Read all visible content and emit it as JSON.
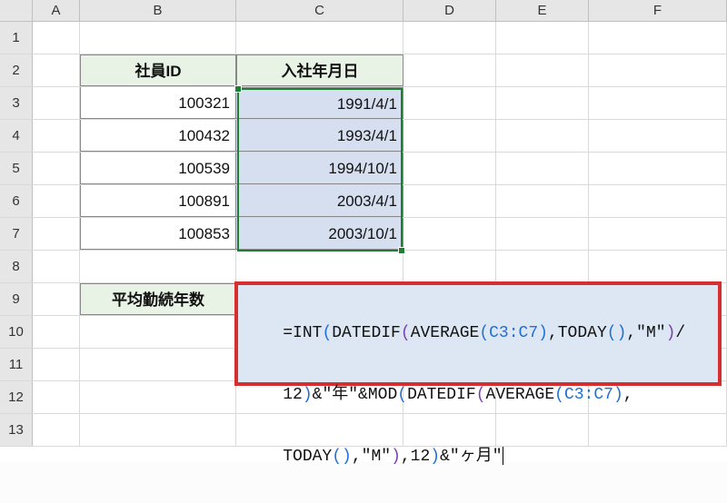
{
  "columns": {
    "A": "A",
    "B": "B",
    "C": "C",
    "D": "D",
    "E": "E",
    "F": "F"
  },
  "rows": {
    "r1": "1",
    "r2": "2",
    "r3": "3",
    "r4": "4",
    "r5": "5",
    "r6": "6",
    "r7": "7",
    "r8": "8",
    "r9": "9",
    "r10": "10",
    "r11": "11",
    "r12": "12",
    "r13": "13"
  },
  "headers": {
    "b2": "社員ID",
    "c2": "入社年月日"
  },
  "data": {
    "b3": "100321",
    "c3": "1991/4/1",
    "b4": "100432",
    "c4": "1993/4/1",
    "b5": "100539",
    "c5": "1994/10/1",
    "b6": "100891",
    "c6": "2003/4/1",
    "b7": "100853",
    "c7": "2003/10/1"
  },
  "label": {
    "b9": "平均勤続年数"
  },
  "formula": {
    "raw": "=INT(DATEDIF(AVERAGE(C3:C7),TODAY(),\"M\")/12)&\"年\"&MOD(DATEDIF(AVERAGE(C3:C7),TODAY(),\"M\"),12)&\"ヶ月\"",
    "p1_a": "=INT",
    "p1_b": "(",
    "p1_c": "DATEDIF",
    "p1_d": "(",
    "p1_e": "AVERAGE",
    "p1_f": "(",
    "p1_g": "C3:C7",
    "p1_h": ")",
    "p1_i": ",TODAY",
    "p1_j": "()",
    "p1_k": ",\"M\"",
    "p1_l": ")",
    "p1_m": "/",
    "p2_a": "12",
    "p2_b": ")",
    "p2_c": "&\"年\"&MOD",
    "p2_d": "(",
    "p2_e": "DATEDIF",
    "p2_f": "(",
    "p2_g": "AVERAGE",
    "p2_h": "(",
    "p2_i": "C3:C7",
    "p2_j": ")",
    "p2_k": ",",
    "p3_a": "TODAY",
    "p3_b": "()",
    "p3_c": ",\"M\"",
    "p3_d": ")",
    "p3_e": ",12",
    "p3_f": ")",
    "p3_g": "&\"ヶ月\""
  },
  "selection": {
    "range": "C3:C7"
  },
  "chart_data": {
    "type": "table",
    "headers": [
      "社員ID",
      "入社年月日"
    ],
    "rows": [
      [
        "100321",
        "1991/4/1"
      ],
      [
        "100432",
        "1993/4/1"
      ],
      [
        "100539",
        "1994/10/1"
      ],
      [
        "100891",
        "2003/4/1"
      ],
      [
        "100853",
        "2003/10/1"
      ]
    ],
    "label": "平均勤続年数",
    "formula": "=INT(DATEDIF(AVERAGE(C3:C7),TODAY(),\"M\")/12)&\"年\"&MOD(DATEDIF(AVERAGE(C3:C7),TODAY(),\"M\"),12)&\"ヶ月\""
  }
}
